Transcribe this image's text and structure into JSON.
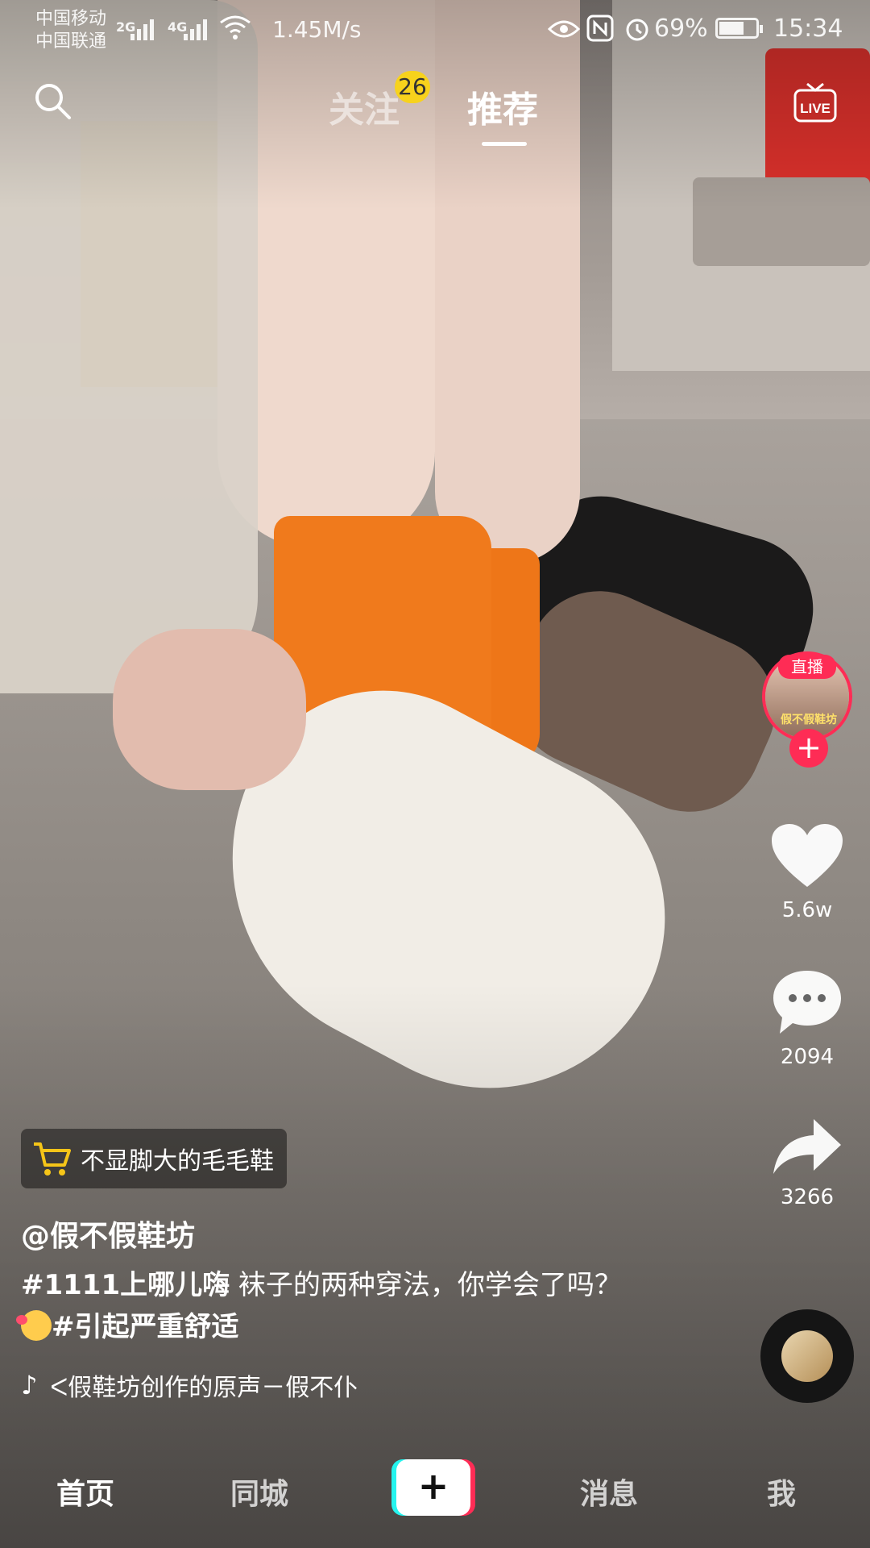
{
  "status_bar": {
    "carrier_1": "中国移动",
    "carrier_2": "中国联通",
    "net_1": "2G",
    "net_2": "4G",
    "speed": "1.45M/s",
    "battery": "69%",
    "battery_level": 0.69,
    "time": "15:34"
  },
  "top_nav": {
    "tab_follow": "关注",
    "follow_badge": "26",
    "tab_recommend": "推荐",
    "live_label": "LIVE"
  },
  "creator": {
    "live_badge": "直播",
    "shop_name": "假不假鞋坊",
    "follow": "+"
  },
  "actions": {
    "likes": "5.6w",
    "comments": "2094",
    "shares": "3266"
  },
  "video": {
    "product_tag": "不显脚大的毛毛鞋",
    "author": "@假不假鞋坊",
    "hashtag_1": "#1111上哪儿嗨",
    "caption": " 袜子的两种穿法，你学会了吗？",
    "hashtag_2": "#引起严重舒适",
    "music": "ᐸ假鞋坊创作的原声－假不仆"
  },
  "bottom_nav": {
    "home": "首页",
    "nearby": "同城",
    "create": "+",
    "messages": "消息",
    "me": "我"
  },
  "colors": {
    "accent": "#fe2c55",
    "cyan": "#25f4ee",
    "badge": "#f7d21c"
  }
}
